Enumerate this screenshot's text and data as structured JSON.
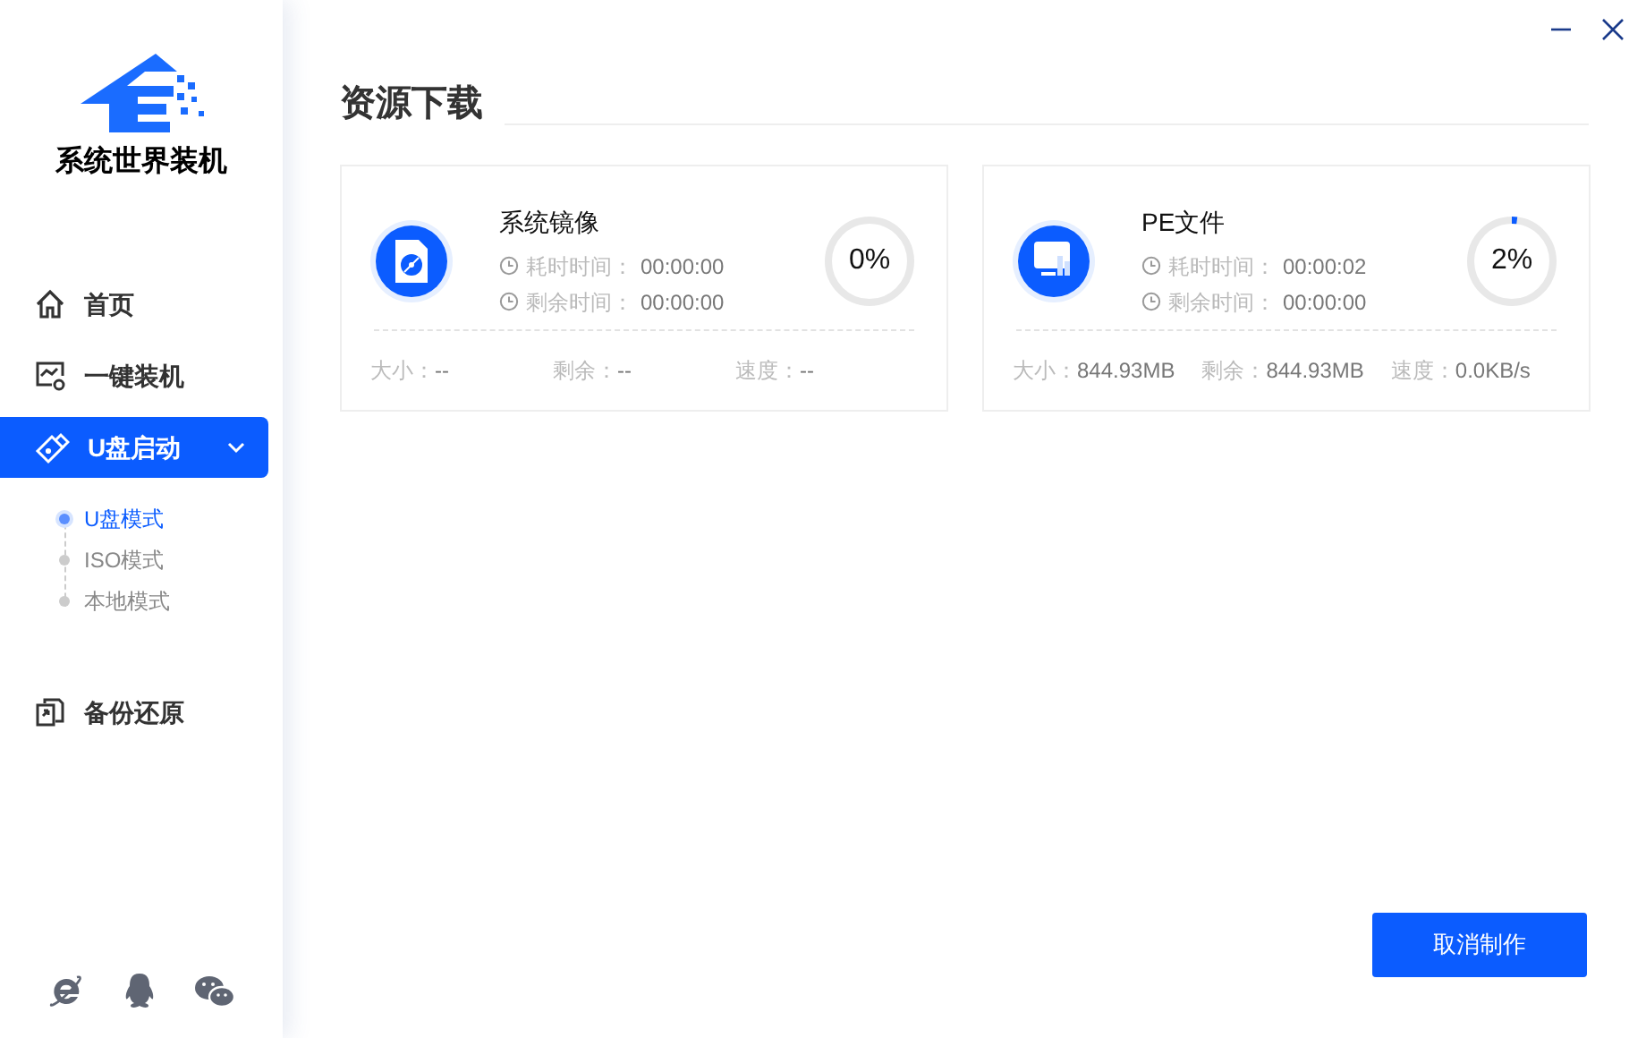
{
  "app": {
    "logo_text": "系统世界装机"
  },
  "window_controls": [
    {
      "kind": "minimize"
    },
    {
      "kind": "close"
    }
  ],
  "sidebar": {
    "items": [
      {
        "label": "首页",
        "kind": "home",
        "selected": false
      },
      {
        "label": "一键装机",
        "kind": "install",
        "selected": false
      },
      {
        "label": "U盘启动",
        "kind": "usb",
        "selected": true,
        "expanded": true,
        "children": [
          {
            "label": "U盘模式",
            "selected": true
          },
          {
            "label": "ISO模式",
            "selected": false
          },
          {
            "label": "本地模式",
            "selected": false
          }
        ]
      },
      {
        "label": "备份还原",
        "kind": "backup",
        "selected": false
      }
    ]
  },
  "footer_icons": [
    {
      "kind": "ie"
    },
    {
      "kind": "qq"
    },
    {
      "kind": "wechat"
    }
  ],
  "page_title": "资源下载",
  "downloads": [
    {
      "name": "系统镜像",
      "kind": "disc",
      "elapsed_label": "耗时时间：",
      "elapsed": "00:00:00",
      "remaining_label": "剩余时间：",
      "remaining": "00:00:00",
      "percent": "0%",
      "level": 0,
      "size_label": "大小：",
      "size": "--",
      "left_label": "剩余：",
      "left": "--",
      "speed_label": "速度：",
      "speed": "--"
    },
    {
      "name": "PE文件",
      "kind": "pe",
      "elapsed_label": "耗时时间：",
      "elapsed": "00:00:02",
      "remaining_label": "剩余时间：",
      "remaining": "00:00:00",
      "percent": "2%",
      "level": 0.02,
      "size_label": "大小：",
      "size": "844.93MB",
      "left_label": "剩余：",
      "left": "844.93MB",
      "speed_label": "速度：",
      "speed": "0.0KB/s"
    }
  ],
  "cancel_button": "取消制作"
}
